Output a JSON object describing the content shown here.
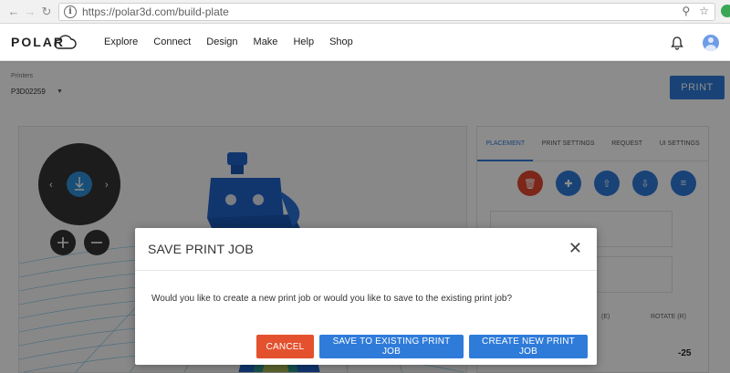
{
  "browser": {
    "url": "https://polar3d.com/build-plate"
  },
  "header": {
    "logo": "POLAR",
    "nav": [
      "Explore",
      "Connect",
      "Design",
      "Make",
      "Help",
      "Shop"
    ]
  },
  "printers": {
    "label": "Printers",
    "selected": "P3D02259"
  },
  "print_button": "PRINT",
  "panel": {
    "tabs": [
      "PLACEMENT",
      "PRINT SETTINGS",
      "REQUEST",
      "UI SETTINGS"
    ],
    "columns": [
      "(E)",
      "ROTATE (R)"
    ],
    "rotate_value": "-25"
  },
  "modal": {
    "title": "SAVE PRINT JOB",
    "body": "Would you like to create a new print job or would you like to save to the existing print job?",
    "cancel": "CANCEL",
    "save_existing": "SAVE TO EXISTING PRINT JOB",
    "create_new": "CREATE NEW PRINT JOB"
  },
  "colors": {
    "primary": "#2e7bd9",
    "cancel": "#e3512e",
    "model": "#1f63c9"
  }
}
